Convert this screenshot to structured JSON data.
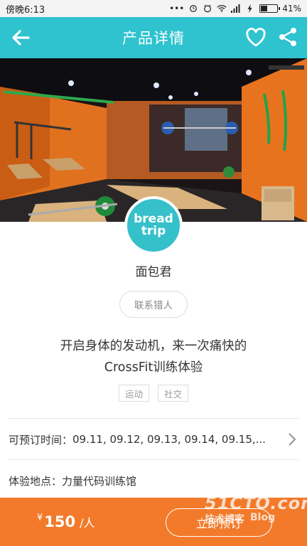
{
  "status_bar": {
    "time": "傍晚6:13",
    "battery_percent": "41%",
    "battery_level": 0.41,
    "icons": [
      "dots-icon",
      "alarm-icon",
      "clock-icon",
      "wifi-icon",
      "signal-icon",
      "charging-icon",
      "battery-icon"
    ]
  },
  "header": {
    "title": "产品详情",
    "back_icon": "arrow-left-icon",
    "favorite_icon": "heart-icon",
    "share_icon": "share-icon",
    "color": "#2ec3cf"
  },
  "host": {
    "avatar_line1": "bread",
    "avatar_line2": "trip",
    "name": "面包君",
    "contact_label": "联系猎人"
  },
  "product": {
    "title_line1": "开启身体的发动机，来一次痛快的",
    "title_line2": "CrossFit训练体验",
    "tags": [
      "运动",
      "社交"
    ]
  },
  "booking": {
    "label": "可预订时间：",
    "dates": "09.11, 09.12, 09.13, 09.14, 09.15,..."
  },
  "location": {
    "label": "体验地点：力量代码训练馆"
  },
  "bottom": {
    "currency": "¥",
    "price": "150",
    "unit": "/人",
    "book_label": "立即预订",
    "color": "#f27a2a"
  },
  "watermark": {
    "line1": "51CTO.com",
    "line2a": "技术博客",
    "line2b": "Blog"
  }
}
